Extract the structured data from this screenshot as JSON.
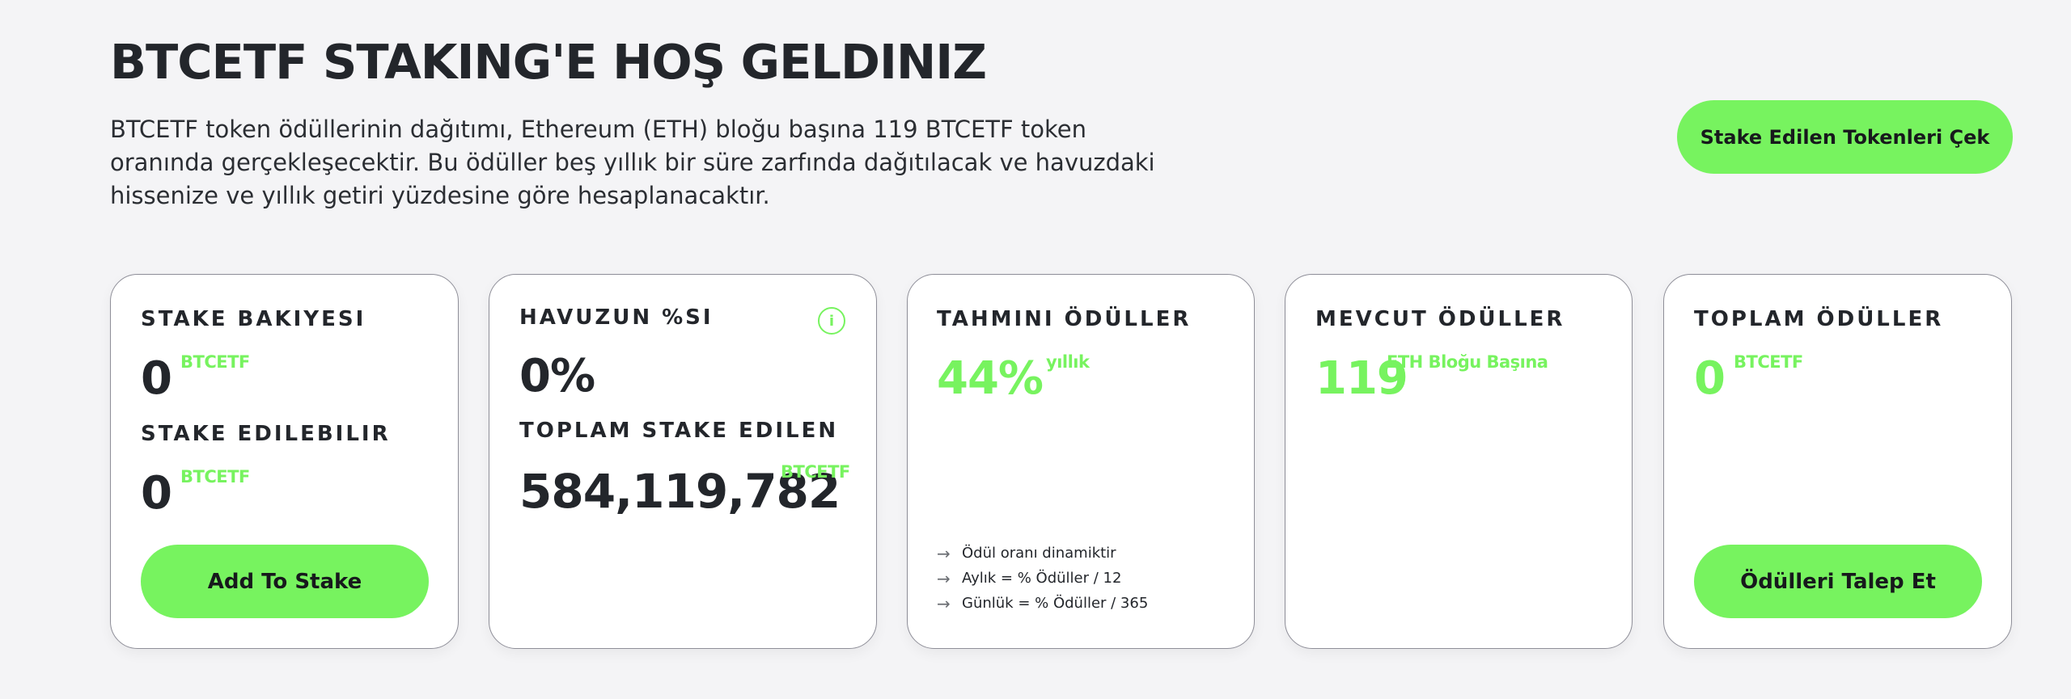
{
  "header": {
    "title": "BTCETF STAKING'E HOŞ GELDINIZ",
    "description": "BTCETF token ödüllerinin dağıtımı, Ethereum (ETH) bloğu başına 119 BTCETF token oranında gerçekleşecektir. Bu ödüller beş yıllık bir süre zarfında dağıtılacak ve havuzdaki hissenize ve yıllık getiri yüzdesine göre hesaplanacaktır.",
    "withdraw_label": "Stake Edilen Tokenleri Çek"
  },
  "cards": {
    "stake_balance": {
      "label": "STAKE BAKIYESI",
      "value": "0",
      "unit": "BTCETF",
      "stakeable_label": "STAKE EDILEBILIR",
      "stakeable_value": "0",
      "stakeable_unit": "BTCETF",
      "button_label": "Add To Stake"
    },
    "pool_share": {
      "label": "HAVUZUN %SI",
      "info_icon": "i",
      "value": "0%",
      "total_label": "TOPLAM STAKE EDILEN",
      "total_value": "584,119,782",
      "total_unit": "BTCETF"
    },
    "estimated_rewards": {
      "label": "TAHMINI ÖDÜLLER",
      "value": "44%",
      "unit": "yıllık",
      "notes": [
        "Ödül oranı dinamiktir",
        "Aylık = % Ödüller / 12",
        "Günlük = % Ödüller / 365"
      ]
    },
    "current_rewards": {
      "label": "MEVCUT ÖDÜLLER",
      "value": "119",
      "unit": "ETH Bloğu Başına"
    },
    "total_rewards": {
      "label": "TOPLAM ÖDÜLLER",
      "value": "0",
      "unit": "BTCETF",
      "button_label": "Ödülleri Talep Et"
    }
  },
  "colors": {
    "accent": "#77f35f",
    "text": "#23262b",
    "background": "#f4f4f6"
  }
}
